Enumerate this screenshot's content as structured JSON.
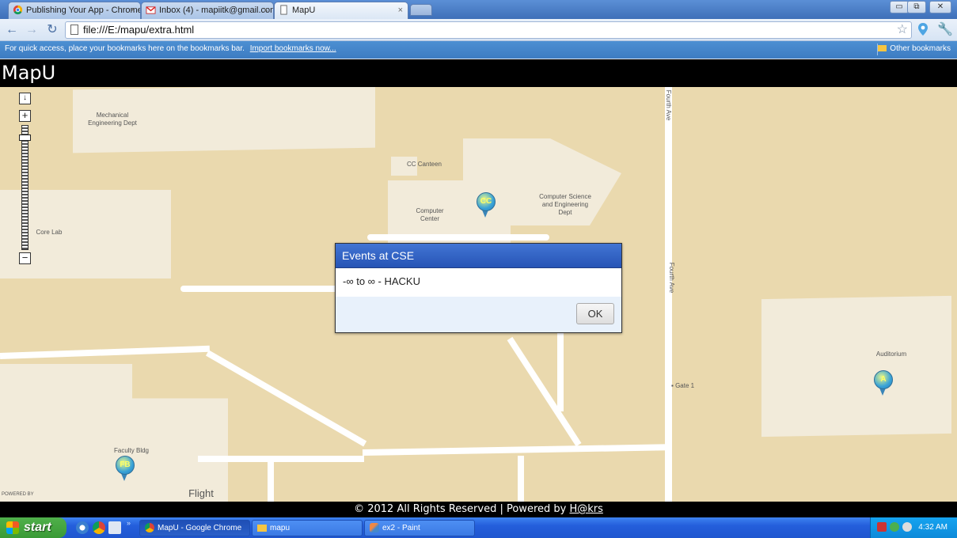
{
  "browser": {
    "tabs": [
      {
        "title": "Publishing Your App - Chrome"
      },
      {
        "title": "Inbox (4) - mapiitk@gmail.com"
      },
      {
        "title": "MapU"
      }
    ],
    "url": "file:///E:/mapu/extra.html",
    "bookmarks_hint": "For quick access, place your bookmarks here on the bookmarks bar.",
    "import_bookmarks": "Import bookmarks now...",
    "other_bookmarks": "Other bookmarks"
  },
  "app": {
    "title": "MapU"
  },
  "map": {
    "labels": {
      "mechanical": "Mechanical Engineering Dept",
      "cc_canteen": "CC Canteen",
      "computer_center": "Computer Center",
      "cse_dept": "Computer Science and Engineering Dept",
      "core_lab": "Core Lab",
      "fourth_ave_top": "Fourth Ave",
      "fourth_ave_mid": "Fourth Ave",
      "gate": "Gate 1",
      "auditorium": "Auditorium",
      "faculty": "Faculty Bldg",
      "flight": "Flight",
      "powered_by": "POWERED BY"
    },
    "markers": {
      "cc": "CC",
      "a": "A",
      "fb": "FB"
    }
  },
  "dialog": {
    "title": "Events at CSE",
    "body": "-∞ to ∞ - HACKU",
    "ok": "OK"
  },
  "footer": {
    "text": "© 2012 All Rights Reserved | Powered by ",
    "brand": "H@krs"
  },
  "taskbar": {
    "start": "start",
    "tasks": [
      {
        "label": "MapU - Google Chrome"
      },
      {
        "label": "mapu"
      },
      {
        "label": "ex2 - Paint"
      }
    ],
    "clock": "4:32 AM"
  }
}
